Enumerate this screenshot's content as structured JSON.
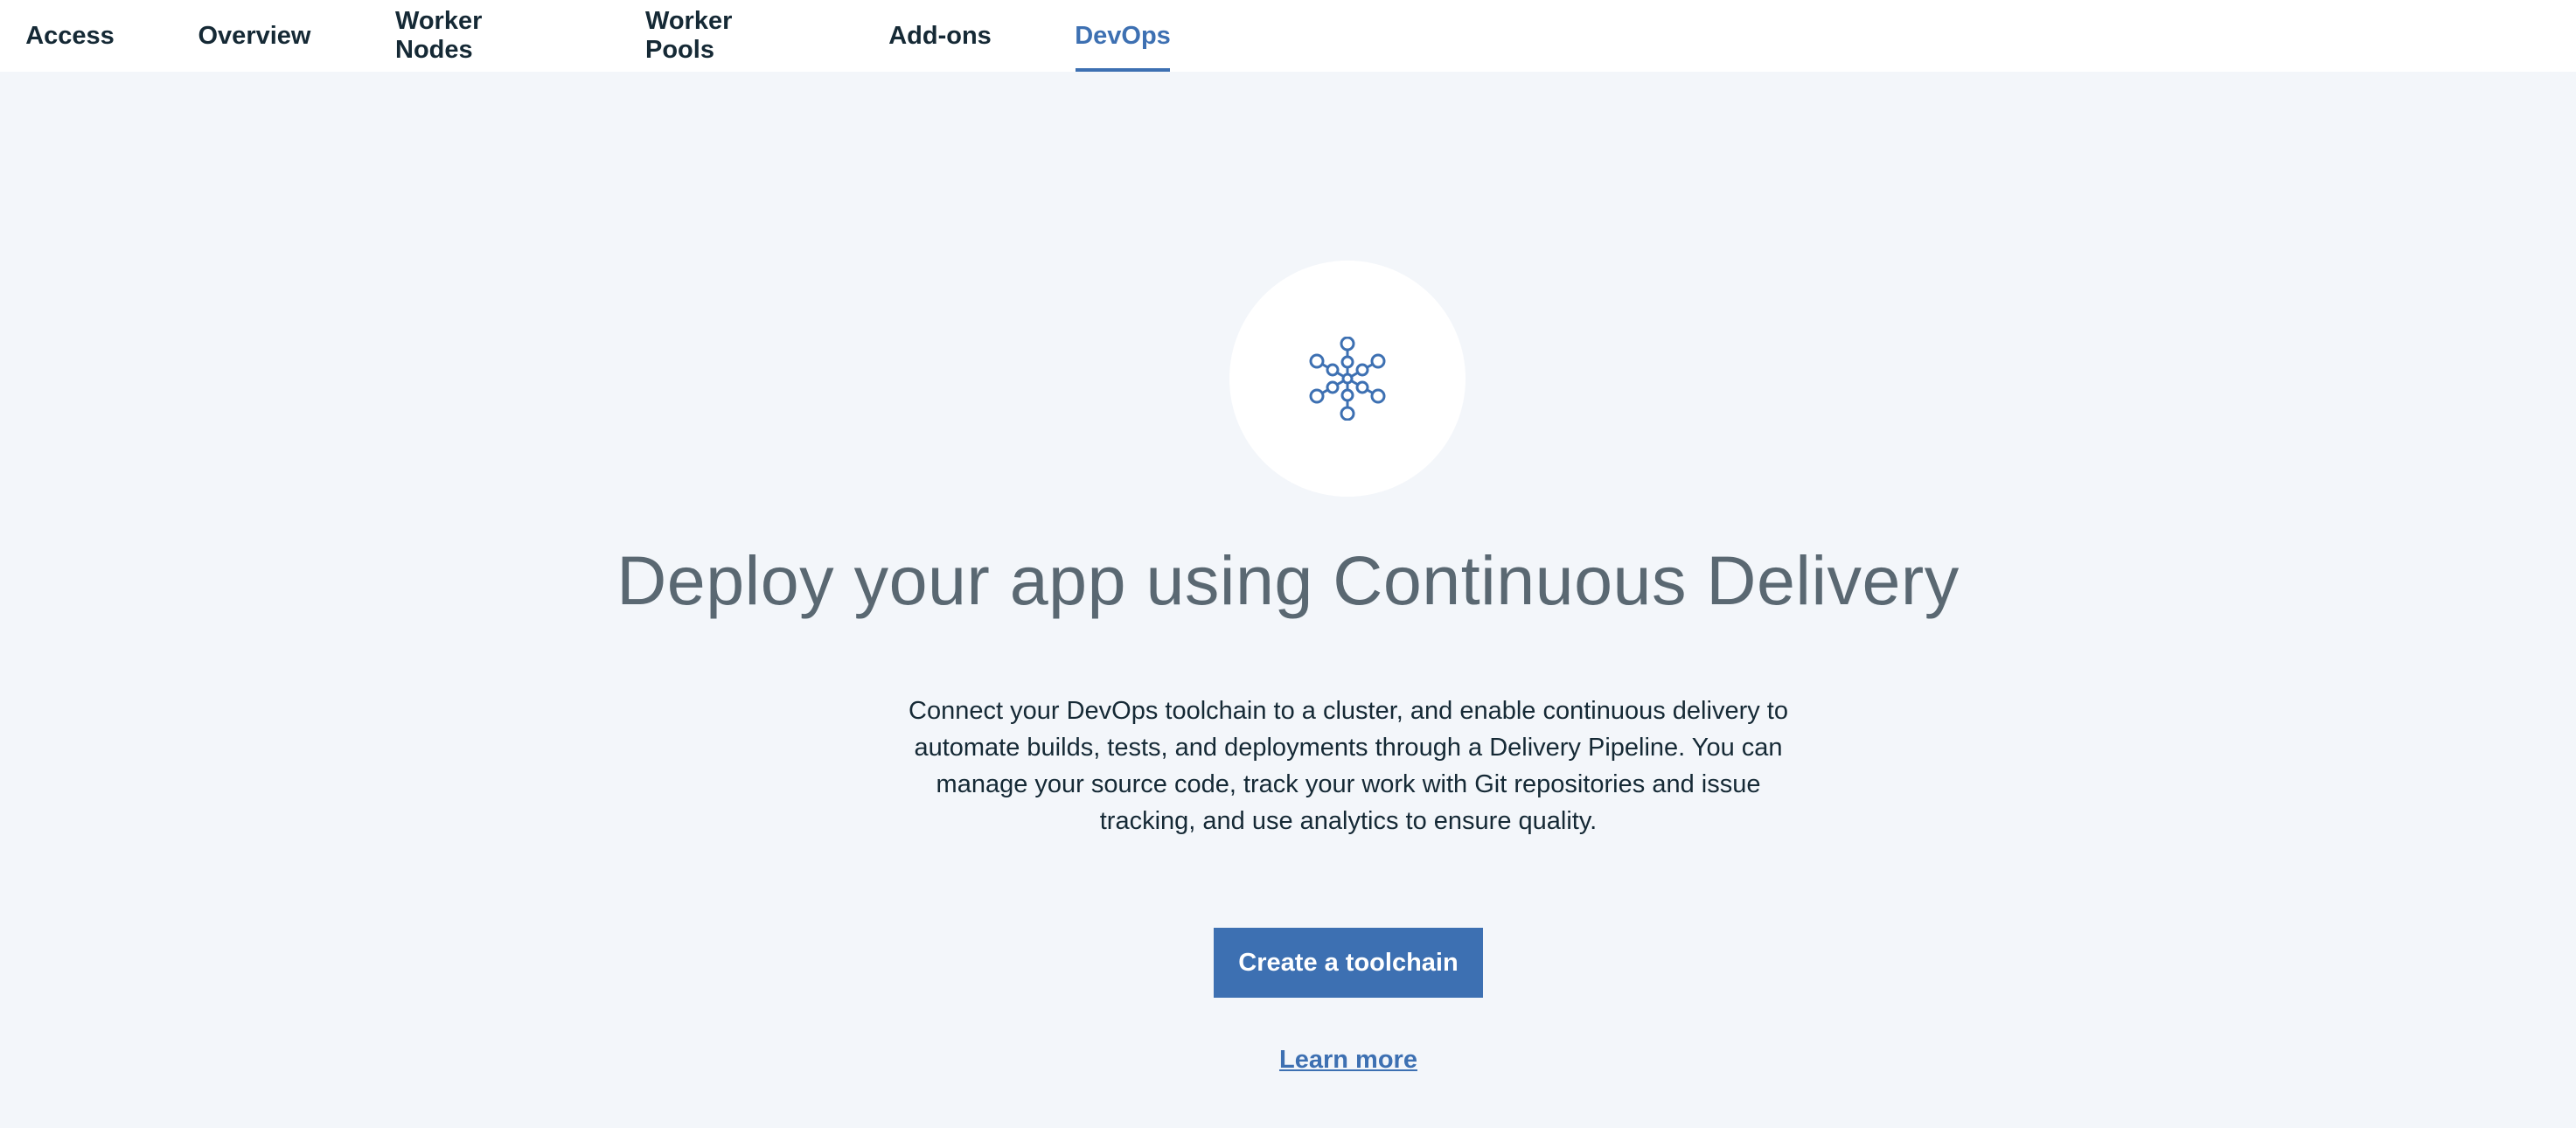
{
  "tabs": [
    {
      "label": "Access",
      "active": false
    },
    {
      "label": "Overview",
      "active": false
    },
    {
      "label": "Worker Nodes",
      "active": false
    },
    {
      "label": "Worker Pools",
      "active": false
    },
    {
      "label": "Add-ons",
      "active": false
    },
    {
      "label": "DevOps",
      "active": true
    }
  ],
  "hero": {
    "icon": "toolchain-network-icon",
    "title": "Deploy your app using Continuous Delivery",
    "description": "Connect your DevOps toolchain to a cluster, and enable continuous delivery to automate builds, tests, and deployments through a Delivery Pipeline. You can manage your source code, track your work with Git repositories and issue tracking, and use analytics to ensure quality.",
    "primary_button": "Create a toolchain",
    "learn_more": "Learn more"
  },
  "colors": {
    "accent": "#3d70b2",
    "background": "#f3f6fa",
    "text": "#152935",
    "muted": "#5a6872"
  }
}
